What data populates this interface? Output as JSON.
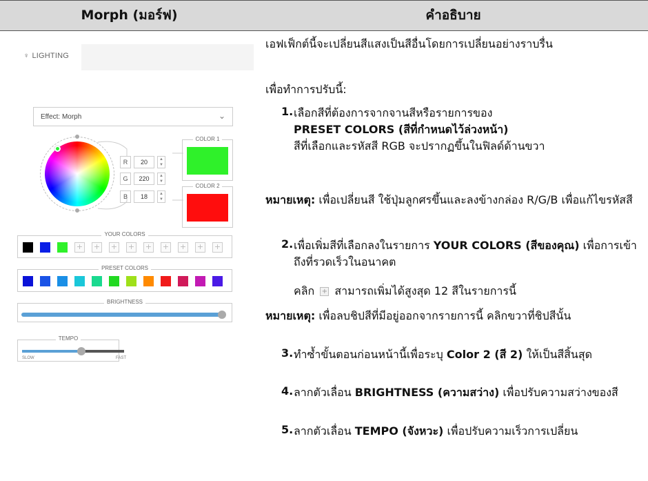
{
  "header": {
    "left": "Morph (มอร์ฟ)",
    "right": "คำอธิบาย"
  },
  "app": {
    "tab": "LIGHTING",
    "effect_value": "Effect: Morph",
    "rgb": [
      {
        "label": "R",
        "value": "20"
      },
      {
        "label": "G",
        "value": "220"
      },
      {
        "label": "B",
        "value": "18"
      }
    ],
    "color1_title": "COLOR 1",
    "color1_hex": "#2ff12a",
    "color2_title": "COLOR 2",
    "color2_hex": "#ff0d0d",
    "your_colors_title": "YOUR COLORS",
    "your_colors": [
      "#000000",
      "#0a1fe6",
      "#2ff12a"
    ],
    "your_colors_empty_slots": 9,
    "preset_colors_title": "PRESET COLORS",
    "preset_colors": [
      "#0a12d8",
      "#1a53e6",
      "#1a8fe6",
      "#1ac7d9",
      "#1ad98f",
      "#22d922",
      "#9fe01a",
      "#ff8a00",
      "#f01a1a",
      "#d01a5a",
      "#c21ab3",
      "#4a1ae6"
    ],
    "brightness_title": "BRIGHTNESS",
    "brightness_level": 1.0,
    "tempo_title": "TEMPO",
    "tempo_slow": "SLOW",
    "tempo_fast": "FAST",
    "tempo_level": 0.5
  },
  "desc": {
    "intro": "เอฟเฟ็กต์นี้จะเปลี่ยนสีแสงเป็นสีอื่นโดยการเปลี่ยนอย่างราบรื่น",
    "lead": "เพื่อทำการปรับนี้:",
    "step1_num": "1.",
    "step1_a": "เลือกสีที่ต้องการจากจานสีหรือรายการของ",
    "step1_b": "PRESET COLORS (สีที่กำหนดไว้ล่วงหน้า)",
    "step1_c": "สีที่เลือกและรหัสสี RGB จะปรากฏขึ้นในฟิลด์ด้านขวา",
    "note1_label": "หมายเหตุ:",
    "note1_text": "เพื่อเปลี่ยนสี ใช้ปุ่มลูกศรขึ้นและลงข้างกล่อง R/G/B เพื่อแก้ไขรหัสสี",
    "step2_num": "2.",
    "step2_a": "เพื่อเพิ่มสีที่เลือกลงในรายการ",
    "step2_b": "YOUR COLORS (สีของคุณ)",
    "step2_c": "เพื่อการเข้าถึงที่รวดเร็วในอนาคต",
    "step2_d1": "คลิก",
    "step2_d2": "สามารถเพิ่มได้สูงสุด 12 สีในรายการนี้",
    "note2_label": "หมายเหตุ:",
    "note2_text": "เพื่อลบชิปสีที่มีอยู่ออกจากรายการนี้ คลิกขวาที่ชิปสีนั้น",
    "step3_num": "3.",
    "step3_a": "ทำซ้ำขั้นตอนก่อนหน้านี้เพื่อระบุ",
    "step3_b": "Color 2 (สี 2)",
    "step3_c": "ให้เป็นสีสิ้นสุด",
    "step4_num": "4.",
    "step4_a": "ลากตัวเลื่อน",
    "step4_b": "BRIGHTNESS (ความสว่าง)",
    "step4_c": "เพื่อปรับความสว่างของสี",
    "step5_num": "5.",
    "step5_a": "ลากตัวเลื่อน",
    "step5_b": "TEMPO (จังหวะ)",
    "step5_c": "เพื่อปรับความเร็วการเปลี่ยน"
  }
}
